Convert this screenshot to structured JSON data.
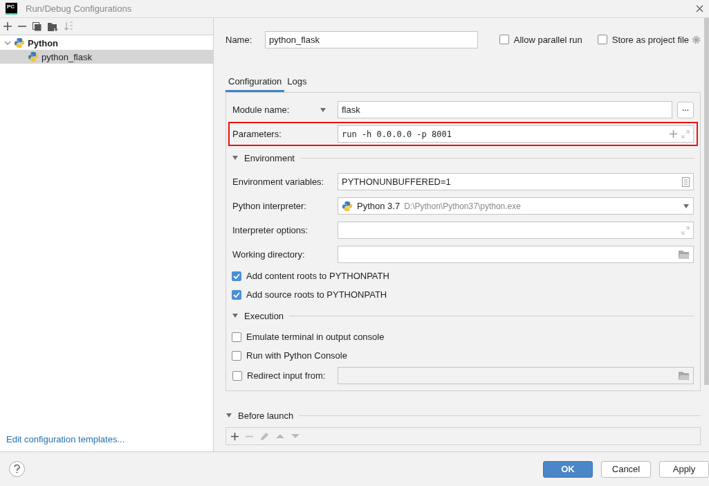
{
  "window": {
    "title": "Run/Debug Configurations",
    "logo": "PC"
  },
  "tree": [
    {
      "label": "Python",
      "expanded": true,
      "selected": false,
      "children": [
        {
          "label": "python_flask",
          "selected": true
        }
      ]
    }
  ],
  "templates_link": "Edit configuration templates...",
  "name": {
    "label": "Name:",
    "value": "python_flask"
  },
  "options": [
    {
      "label": "Allow parallel run",
      "checked": false
    },
    {
      "label": "Store as project file",
      "checked": false
    }
  ],
  "tabs": [
    {
      "label": "Configuration",
      "selected": true
    },
    {
      "label": "Logs",
      "selected": false
    }
  ],
  "form": [
    {
      "kind": "module",
      "label": "Module name:",
      "value": "flask",
      "more": "..."
    },
    {
      "kind": "parameters",
      "label": "Parameters:",
      "value": "run -h 0.0.0.0 -p 8001",
      "highlighted": true
    },
    {
      "kind": "section",
      "title": "Environment",
      "expanded": true
    },
    {
      "kind": "envvars",
      "label": "Environment variables:",
      "value": "PYTHONUNBUFFERED=1"
    },
    {
      "kind": "interpreter",
      "label": "Python interpreter:",
      "value": "Python 3.7",
      "path": "D:\\Python\\Python37\\python.exe"
    },
    {
      "kind": "options",
      "label": "Interpreter options:"
    },
    {
      "kind": "directory",
      "label": "Working directory:"
    },
    {
      "kind": "checkbox",
      "label": "Add content roots to PYTHONPATH",
      "checked": true
    },
    {
      "kind": "checkbox",
      "label": "Add source roots to PYTHONPATH",
      "checked": true
    },
    {
      "kind": "section",
      "title": "Execution",
      "expanded": true
    },
    {
      "kind": "checkbox",
      "label": "Emulate terminal in output console",
      "checked": false
    },
    {
      "kind": "checkbox",
      "label": "Run with Python Console",
      "checked": false
    },
    {
      "kind": "redirect",
      "label": "Redirect input from:",
      "checked": false,
      "disabled": true
    }
  ],
  "before_launch": {
    "title": "Before launch",
    "expanded": true
  },
  "buttons": [
    {
      "label": "OK",
      "primary": true
    },
    {
      "label": "Cancel",
      "primary": false
    },
    {
      "label": "Apply",
      "primary": false
    }
  ]
}
